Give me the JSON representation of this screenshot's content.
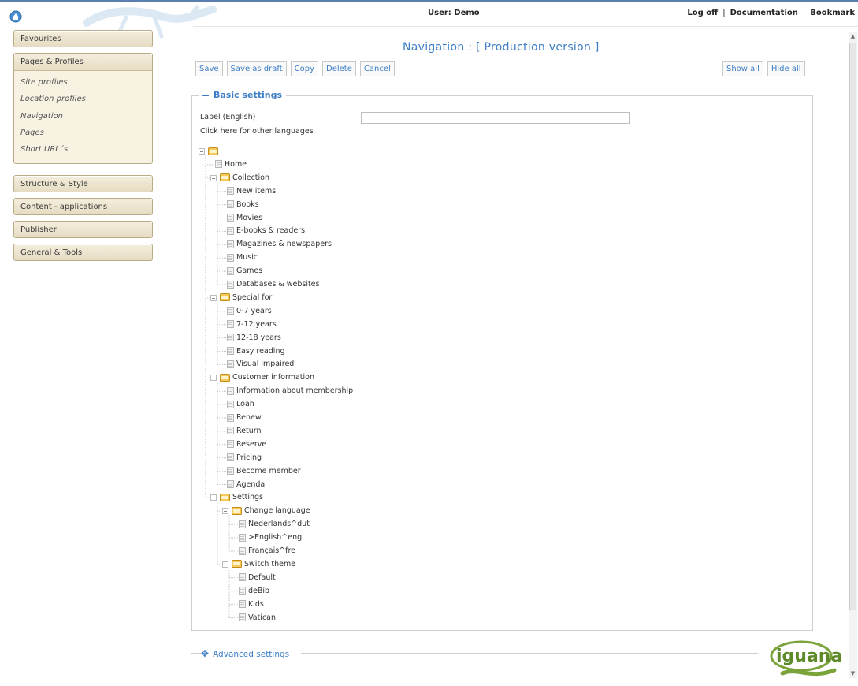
{
  "header": {
    "user": "User: Demo",
    "links": [
      "Log off",
      "Documentation",
      "Bookmark"
    ]
  },
  "sidebar": {
    "favourites": "Favourites",
    "pages_profiles": "Pages & Profiles",
    "sub_items": [
      "Site profiles",
      "Location profiles",
      "Navigation",
      "Pages",
      "Short URL´s"
    ],
    "others": [
      "Structure & Style",
      "Content - applications",
      "Publisher",
      "General & Tools"
    ]
  },
  "main": {
    "title": "Navigation : [ Production version ]",
    "toolbar_left": [
      "Save",
      "Save as draft",
      "Copy",
      "Delete",
      "Cancel"
    ],
    "toolbar_right": [
      "Show all",
      "Hide all"
    ],
    "basic_settings": "Basic settings",
    "label_field": "Label (English)",
    "label_value": "",
    "other_languages": "Click here for other languages",
    "advanced_settings": "Advanced settings"
  },
  "tree": [
    {
      "label": "",
      "type": "folder",
      "depth": 0
    },
    {
      "label": "Home",
      "type": "page",
      "depth": 1
    },
    {
      "label": "Collection",
      "type": "folder",
      "depth": 1
    },
    {
      "label": "New items",
      "type": "page",
      "depth": 2
    },
    {
      "label": "Books",
      "type": "page",
      "depth": 2
    },
    {
      "label": "Movies",
      "type": "page",
      "depth": 2
    },
    {
      "label": "E-books & readers",
      "type": "page",
      "depth": 2
    },
    {
      "label": "Magazines & newspapers",
      "type": "page",
      "depth": 2
    },
    {
      "label": "Music",
      "type": "page",
      "depth": 2
    },
    {
      "label": "Games",
      "type": "page",
      "depth": 2
    },
    {
      "label": "Databases & websites",
      "type": "page",
      "depth": 2
    },
    {
      "label": "Special for",
      "type": "folder",
      "depth": 1
    },
    {
      "label": "0-7 years",
      "type": "page",
      "depth": 2
    },
    {
      "label": "7-12 years",
      "type": "page",
      "depth": 2
    },
    {
      "label": "12-18 years",
      "type": "page",
      "depth": 2
    },
    {
      "label": "Easy reading",
      "type": "page",
      "depth": 2
    },
    {
      "label": "Visual impaired",
      "type": "page",
      "depth": 2
    },
    {
      "label": "Customer information",
      "type": "folder",
      "depth": 1
    },
    {
      "label": "Information about membership",
      "type": "page",
      "depth": 2
    },
    {
      "label": "Loan",
      "type": "page",
      "depth": 2
    },
    {
      "label": "Renew",
      "type": "page",
      "depth": 2
    },
    {
      "label": "Return",
      "type": "page",
      "depth": 2
    },
    {
      "label": "Reserve",
      "type": "page",
      "depth": 2
    },
    {
      "label": "Pricing",
      "type": "page",
      "depth": 2
    },
    {
      "label": "Become member",
      "type": "page",
      "depth": 2
    },
    {
      "label": "Agenda",
      "type": "page",
      "depth": 2
    },
    {
      "label": "Settings",
      "type": "folder",
      "depth": 1
    },
    {
      "label": "Change language",
      "type": "folder",
      "depth": 2
    },
    {
      "label": "Nederlands^dut",
      "type": "page",
      "depth": 3
    },
    {
      "label": ">English^eng",
      "type": "page",
      "depth": 3
    },
    {
      "label": "Français^fre",
      "type": "page",
      "depth": 3
    },
    {
      "label": "Switch theme",
      "type": "folder",
      "depth": 2
    },
    {
      "label": "Default",
      "type": "page",
      "depth": 3
    },
    {
      "label": "deBib",
      "type": "page",
      "depth": 3
    },
    {
      "label": "Kids",
      "type": "page",
      "depth": 3
    },
    {
      "label": "Vatican",
      "type": "page",
      "depth": 3
    }
  ],
  "logo": {
    "text": "iguana"
  },
  "colors": {
    "accent": "#3d7ec6",
    "sidebar_bg": "#f4eedd",
    "sidebar_border": "#b9ab88",
    "logo_green": "#5f8a2a"
  }
}
